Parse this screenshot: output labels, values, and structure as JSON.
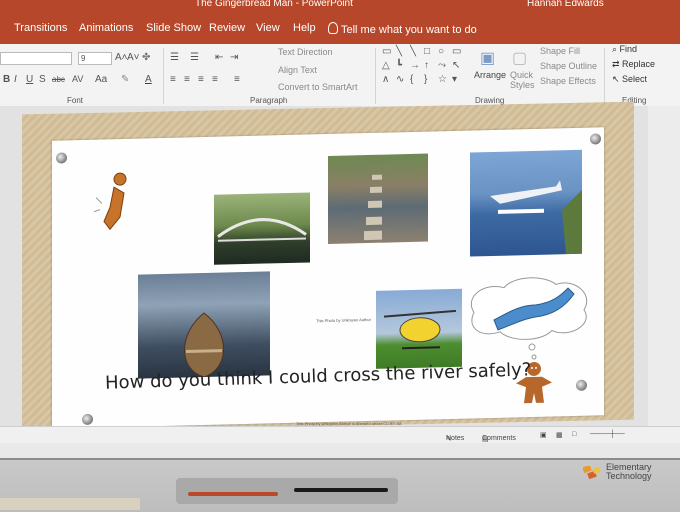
{
  "window": {
    "title": "The Gingerbread Man  -  PowerPoint",
    "user": "Hannah Edwards"
  },
  "tabs": [
    "Transitions",
    "Animations",
    "Slide Show",
    "Review",
    "View",
    "Help"
  ],
  "tell_me": "Tell me what you want to do",
  "ribbon": {
    "font_size": "9",
    "groups": {
      "font": "Font",
      "paragraph": "Paragraph",
      "drawing": "Drawing",
      "editing": "Editing"
    },
    "paragraph_buttons": {
      "text_direction": "Text Direction",
      "align_text": "Align Text",
      "smartart": "Convert to SmartArt"
    },
    "drawing_buttons": {
      "arrange": "Arrange",
      "quick_styles": "Quick Styles",
      "shape_fill": "Shape Fill",
      "shape_outline": "Shape Outline",
      "shape_effects": "Shape Effects"
    },
    "editing_buttons": {
      "find": "Find",
      "replace": "Replace",
      "select": "Select"
    },
    "font_controls": {
      "b": "B",
      "i": "I",
      "u": "U",
      "s": "S",
      "abc": "abc",
      "av": "AV",
      "aa": "Aa",
      "a": "A",
      "grow": "A˄",
      "shrink": "A˅"
    }
  },
  "slide": {
    "caption": "How do you think I could cross the river safely?",
    "credit1": "This Photo by Unknown Author",
    "credit2": "This Photo by Unknown Author is licensed under CC BY-SA"
  },
  "statusbar": {
    "notes": "Notes",
    "comments": "Comments"
  },
  "device": {
    "brand_line1": "Elementary",
    "brand_line2": "Technology"
  },
  "colors": {
    "ribbon_accent": "#b7472a",
    "slide_bg": "#fefefe",
    "cork": "#d9c7a4"
  }
}
